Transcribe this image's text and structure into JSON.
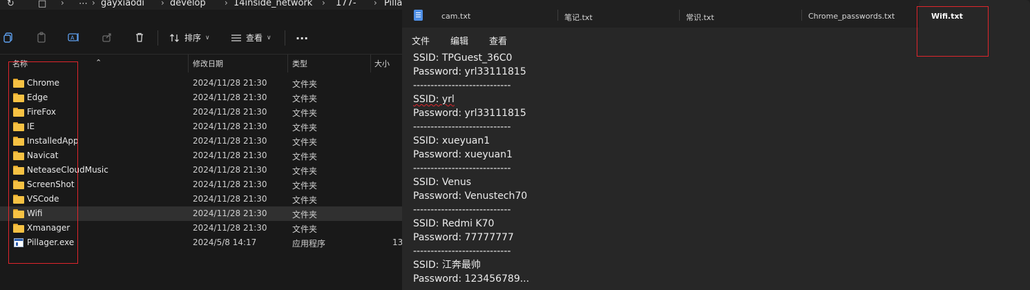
{
  "explorer": {
    "breadcrumb": [
      "gayxiaodi",
      "develop",
      "14inside_network",
      "177-",
      "Pilla"
    ],
    "toolbar": {
      "sort_label": "排序",
      "view_label": "查看",
      "more_label": "..."
    },
    "columns": {
      "name": "名称",
      "date": "修改日期",
      "type": "类型",
      "size": "大小"
    },
    "rows": [
      {
        "name": "Chrome",
        "date": "2024/11/28 21:30",
        "type": "文件夹",
        "size": "",
        "icon": "folder-icon"
      },
      {
        "name": "Edge",
        "date": "2024/11/28 21:30",
        "type": "文件夹",
        "size": "",
        "icon": "folder-icon"
      },
      {
        "name": "FireFox",
        "date": "2024/11/28 21:30",
        "type": "文件夹",
        "size": "",
        "icon": "folder-icon"
      },
      {
        "name": "IE",
        "date": "2024/11/28 21:30",
        "type": "文件夹",
        "size": "",
        "icon": "folder-icon"
      },
      {
        "name": "InstalledApp",
        "date": "2024/11/28 21:30",
        "type": "文件夹",
        "size": "",
        "icon": "folder-icon"
      },
      {
        "name": "Navicat",
        "date": "2024/11/28 21:30",
        "type": "文件夹",
        "size": "",
        "icon": "folder-icon"
      },
      {
        "name": "NeteaseCloudMusic",
        "date": "2024/11/28 21:30",
        "type": "文件夹",
        "size": "",
        "icon": "folder-icon"
      },
      {
        "name": "ScreenShot",
        "date": "2024/11/28 21:30",
        "type": "文件夹",
        "size": "",
        "icon": "folder-icon"
      },
      {
        "name": "VSCode",
        "date": "2024/11/28 21:30",
        "type": "文件夹",
        "size": "",
        "icon": "folder-icon"
      },
      {
        "name": "Wifi",
        "date": "2024/11/28 21:30",
        "type": "文件夹",
        "size": "",
        "icon": "folder-icon"
      },
      {
        "name": "Xmanager",
        "date": "2024/11/28 21:30",
        "type": "文件夹",
        "size": "",
        "icon": "folder-icon"
      },
      {
        "name": "Pillager.exe",
        "date": "2024/5/8 14:17",
        "type": "应用程序",
        "size": "13",
        "icon": "exe-icon"
      }
    ],
    "selected_row": "Wifi"
  },
  "notepad": {
    "tabs": [
      "cam.txt",
      "笔记.txt",
      "常识.txt",
      "Chrome_passwords.txt",
      "Wifi.txt"
    ],
    "active_tab": "Wifi.txt",
    "menu": [
      "文件",
      "编辑",
      "查看"
    ],
    "lines": [
      "SSID: TPGuest_36C0",
      "Password: yrl33111815",
      "----------------------------",
      "SSID: yrl",
      "Password: yrl33111815",
      "----------------------------",
      "SSID: xueyuan1",
      "Password: xueyuan1",
      "----------------------------",
      "SSID: Venus",
      "Password: Venustech70",
      "----------------------------",
      "SSID: Redmi K70",
      "Password: 77777777",
      "----------------------------",
      "SSID: 江奔最帅",
      "Password: 123456789..."
    ]
  },
  "colors": {
    "highlight_box": "#e0252c",
    "folder": "#f6c243",
    "accent": "#4f8fe6"
  }
}
